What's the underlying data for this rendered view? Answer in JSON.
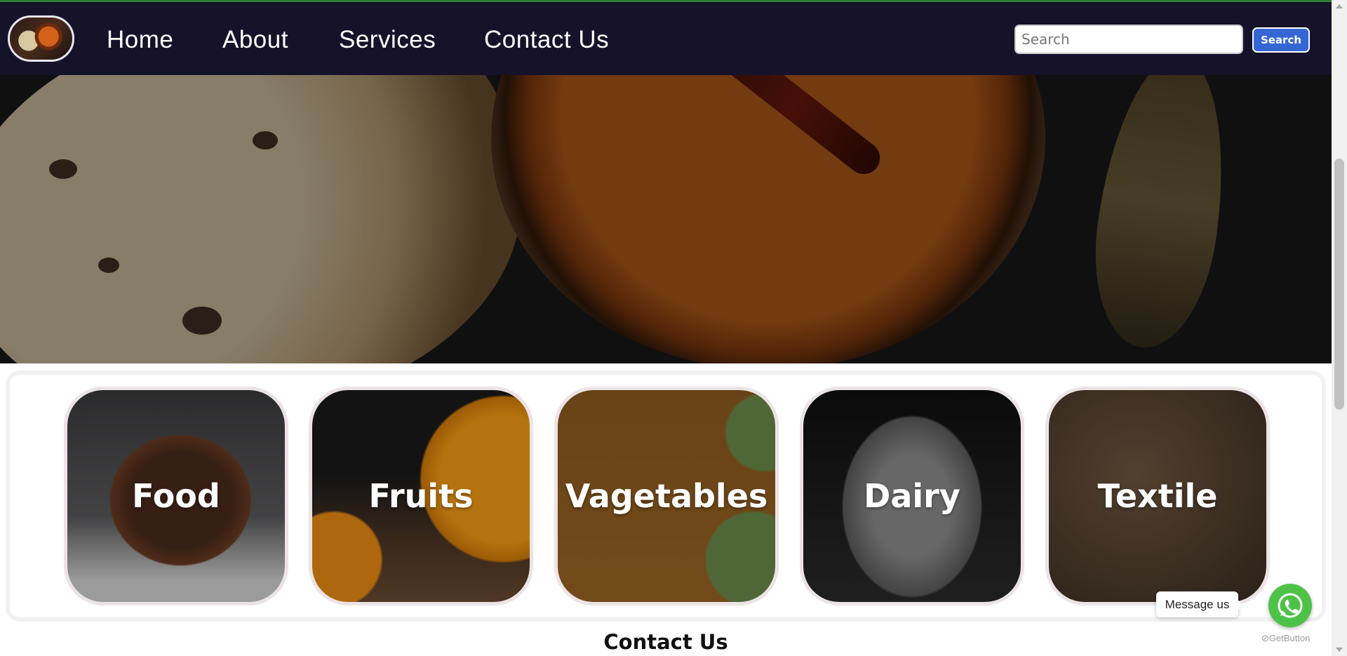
{
  "nav": {
    "links": [
      {
        "label": "Home"
      },
      {
        "label": "About"
      },
      {
        "label": "Services"
      },
      {
        "label": "Contact Us"
      }
    ],
    "logo_icon": "food-logo-icon"
  },
  "search": {
    "placeholder": "Search",
    "value": "",
    "button_label": "Search"
  },
  "categories": [
    {
      "label": "Food"
    },
    {
      "label": "Fruits"
    },
    {
      "label": "Vagetables"
    },
    {
      "label": "Dairy"
    },
    {
      "label": "Textile"
    }
  ],
  "contact": {
    "heading": "Contact Us"
  },
  "whatsapp": {
    "message_label": "Message us",
    "icon": "whatsapp-icon",
    "brand": "GetButton"
  },
  "colors": {
    "navbar": "#15122a",
    "search_button": "#3566d6",
    "whatsapp": "#4dc247",
    "top_accent": "#2e7d32"
  }
}
